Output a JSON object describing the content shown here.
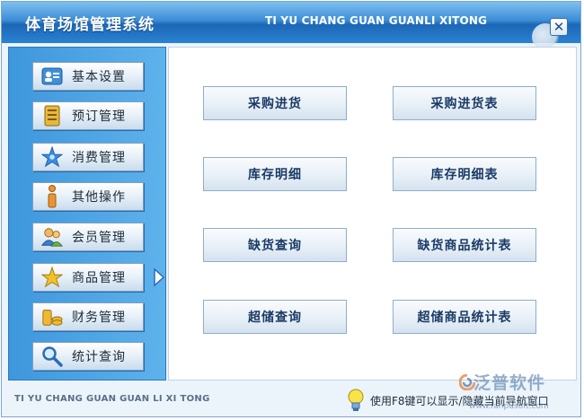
{
  "window": {
    "title_cn": "体育场馆管理系统",
    "title_en": "TI YU CHANG GUAN GUANLI XITONG",
    "close_label": "✕"
  },
  "sidebar": {
    "items": [
      {
        "label": "基本设置",
        "icon": "id-card-icon"
      },
      {
        "label": "预订管理",
        "icon": "notebook-icon"
      },
      {
        "label": "消费管理",
        "icon": "star-shine-icon"
      },
      {
        "label": "其他操作",
        "icon": "info-person-icon"
      },
      {
        "label": "会员管理",
        "icon": "users-icon"
      },
      {
        "label": "商品管理",
        "icon": "star-icon"
      },
      {
        "label": "财务管理",
        "icon": "coins-icon"
      },
      {
        "label": "统计查询",
        "icon": "magnifier-icon"
      }
    ],
    "active_item": "商品管理"
  },
  "content": {
    "buttons": [
      {
        "label": "采购进货"
      },
      {
        "label": "采购进货表"
      },
      {
        "label": "库存明细"
      },
      {
        "label": "库存明细表"
      },
      {
        "label": "缺货查询"
      },
      {
        "label": "缺货商品统计表"
      },
      {
        "label": "超储查询"
      },
      {
        "label": "超储商品统计表"
      }
    ]
  },
  "footer": {
    "text_en": "TI YU CHANG GUAN GUAN LI XI TONG",
    "hint": "使用F8键可以显示/隐藏当前导航窗口"
  },
  "watermark": {
    "text": "泛普软件",
    "url": "www.fanpusoft.com"
  },
  "colors": {
    "title_bar": "#2a82d2",
    "sidebar": "#4ea6e6",
    "button_text": "#1a3a66"
  }
}
